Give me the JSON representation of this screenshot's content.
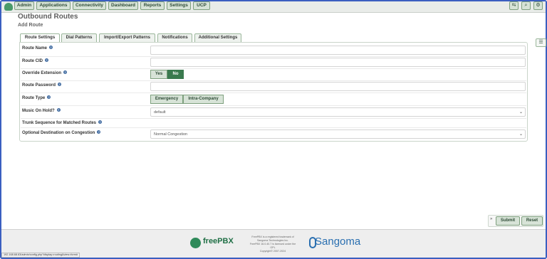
{
  "nav": {
    "items": [
      "Admin",
      "Applications",
      "Connectivity",
      "Dashboard",
      "Reports",
      "Settings",
      "UCP"
    ],
    "tools": [
      "language-icon",
      "search-icon",
      "gear-icon"
    ]
  },
  "page": {
    "title": "Outbound Routes",
    "subtitle": "Add Route"
  },
  "tabs": [
    "Route Settings",
    "Dial Patterns",
    "Import/Export Patterns",
    "Notifications",
    "Additional Settings"
  ],
  "form": {
    "route_name": {
      "label": "Route Name",
      "value": ""
    },
    "route_cid": {
      "label": "Route CID",
      "value": ""
    },
    "override_extension": {
      "label": "Override Extension",
      "options": [
        "Yes",
        "No"
      ],
      "selected": "No"
    },
    "route_password": {
      "label": "Route Password",
      "value": ""
    },
    "route_type": {
      "label": "Route Type",
      "options": [
        "Emergency",
        "Intra-Company"
      ]
    },
    "music_on_hold": {
      "label": "Music On Hold?",
      "value": "default"
    },
    "trunk_sequence": {
      "label": "Trunk Sequence for Matched Routes"
    },
    "optional_destination": {
      "label": "Optional Destination on Congestion",
      "value": "Normal Congestion"
    }
  },
  "actions": {
    "collapse": "»",
    "submit": "Submit",
    "reset": "Reset"
  },
  "footer": {
    "brand": "freePBX",
    "legal": [
      "FreePBX is a registered trademark of",
      "Sangoma Technologies Inc.",
      "FreePBX 16.0.40.7 is licensed under the",
      "GPL",
      "Copyright© 2007-2024"
    ],
    "partner": "Sangoma"
  },
  "status_url": "192.168.68.63/admin/config.php?display=routing&view=form#"
}
